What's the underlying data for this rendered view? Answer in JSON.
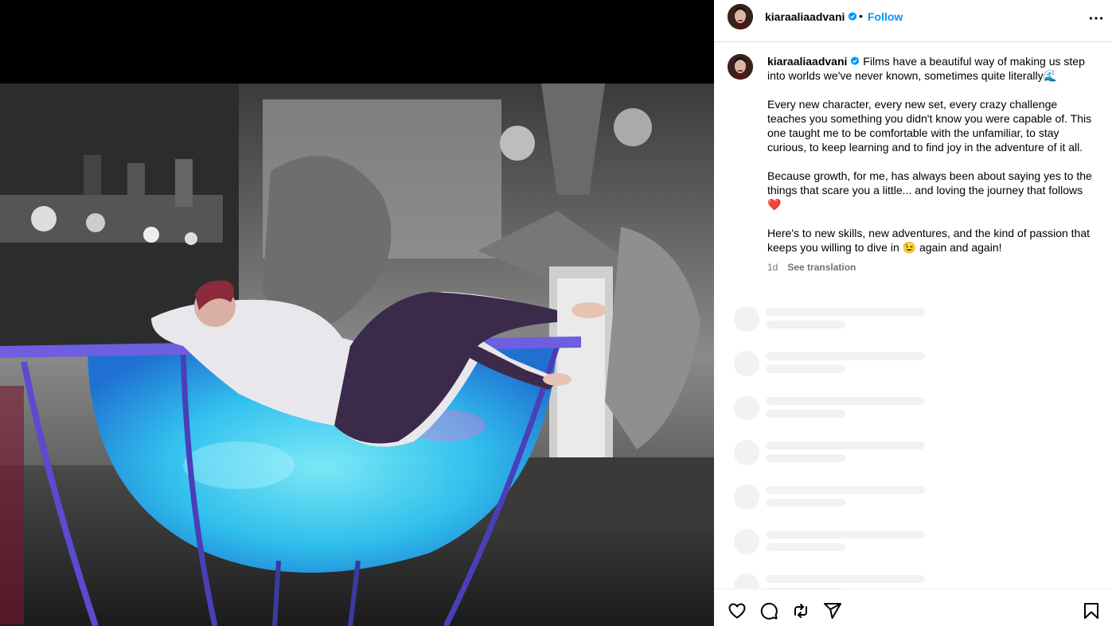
{
  "post": {
    "username": "kiaraaliaadvani",
    "dot": "•",
    "follow_label": "Follow"
  },
  "caption": {
    "username": "kiaraaliaadvani",
    "line1": "Films have a beautiful way of making us step into worlds we've never known, sometimes quite literally🌊",
    "para2": "Every new character, every new set, every crazy challenge teaches you something you didn't know you were capable of. This one taught me to be comfortable with the unfamiliar, to stay curious, to keep learning and to find joy in the adventure of it all.",
    "para3": "Because growth, for me, has always been about saying yes to the things that scare you a little... and loving the journey that follows ❤️",
    "para4": "Here's to new skills, new adventures, and the kind of passion that keeps you willing to dive in 😉 again and again!",
    "time": "1d",
    "see_translation": "See translation"
  },
  "icons": {
    "more": "more-options-icon",
    "verified": "verified-badge-icon",
    "like": "heart-icon",
    "comment": "comment-icon",
    "repost": "repost-icon",
    "share": "share-icon",
    "save": "bookmark-icon"
  },
  "colors": {
    "link": "#0095f6",
    "verified": "#0095f6",
    "muted": "#737373",
    "skeleton": "#f2f2f2"
  }
}
